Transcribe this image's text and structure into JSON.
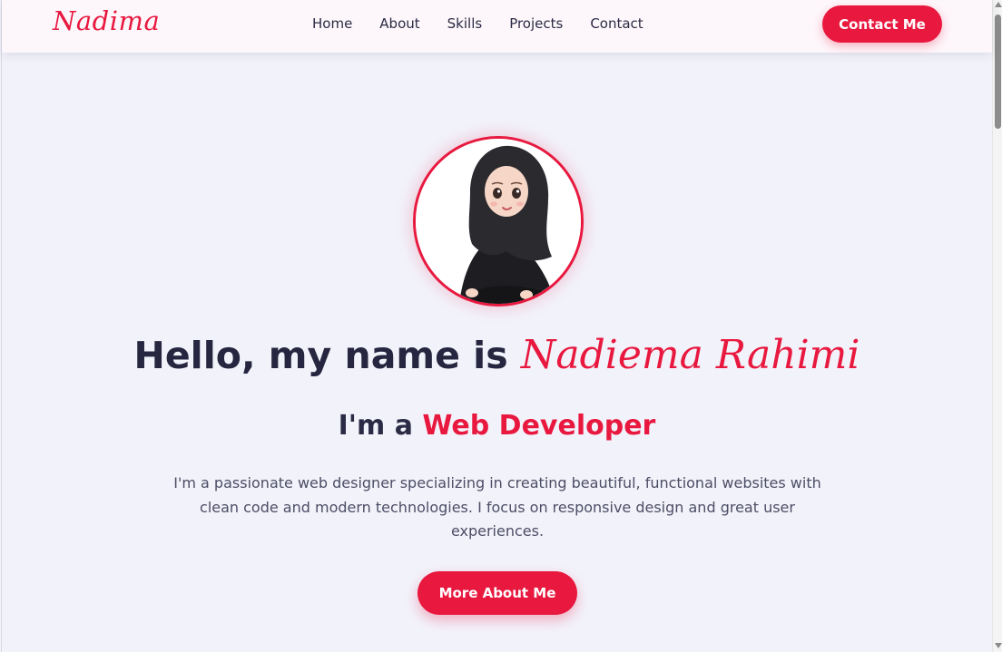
{
  "header": {
    "logo": "Nadima",
    "nav": [
      {
        "label": "Home"
      },
      {
        "label": "About"
      },
      {
        "label": "Skills"
      },
      {
        "label": "Projects"
      },
      {
        "label": "Contact"
      }
    ],
    "cta_label": "Contact Me"
  },
  "hero": {
    "greeting": "Hello, my name is ",
    "name": "Nadiema Rahimi",
    "role_prefix": "I'm a ",
    "role": "Web Developer",
    "description": "I'm a passionate web designer specializing in creating beautiful, functional websites with clean code and modern technologies. I focus on responsive design and great user experiences.",
    "button_label": "More About Me"
  },
  "colors": {
    "accent": "#e8183f",
    "heading": "#262640",
    "background": "#f2f2fa",
    "header_bg": "#fdf6fa"
  },
  "icons": {
    "avatar": "avatar-illustration-icon",
    "scroll_up": "scroll-up-arrow-icon",
    "scroll_down": "scroll-down-arrow-icon"
  }
}
